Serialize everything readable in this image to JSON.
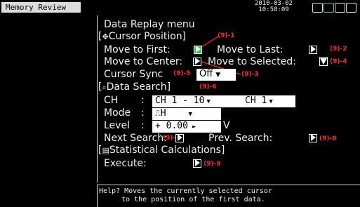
{
  "header": {
    "title": "Memory Review",
    "date": "2010-03-02",
    "time": "10:58:09",
    "status_icons": [
      "memory-card-icon",
      "storage-icon",
      "usb-icon",
      "lock-icon"
    ]
  },
  "menu": {
    "title": "Data Replay menu",
    "cursor_position": {
      "section_label": "Cursor Position",
      "move_first": "Move to First:",
      "move_last": "Move to Last:",
      "move_center": "Move to Center:",
      "move_selected": "Move to Selected:"
    },
    "cursor_sync": {
      "label": "Cursor Sync",
      "value": "Off"
    },
    "data_search": {
      "section_label": "Data Search",
      "ch_label": "CH",
      "ch_range": "CH  1 -  10",
      "ch_select": "CH  1",
      "mode_label": "Mode",
      "mode_value": "H",
      "level_label": "Level",
      "level_value": "+  0.00",
      "level_unit": "V",
      "next_search": "Next Search:",
      "prev_search": "Prev. Search:"
    },
    "statistics": {
      "section_label": "Statistical Calculations",
      "execute": "Execute:"
    }
  },
  "annotations": {
    "a1": "(9)-1",
    "a2": "(9)-2",
    "a3": "(9)-3",
    "a4": "(9)-4",
    "a5": "(9)-5",
    "a6": "(9)-6",
    "a7": "(9)-7",
    "a8": "(9)-8",
    "a9": "(9)-9"
  },
  "help": {
    "line1": "Help? Moves the currently selected cursor",
    "line2": "to the position of the first data."
  },
  "colors": {
    "accent_green": "#3bd55e",
    "annotation_red": "#ff2a2a",
    "title_bg": "#dcdcdc"
  }
}
